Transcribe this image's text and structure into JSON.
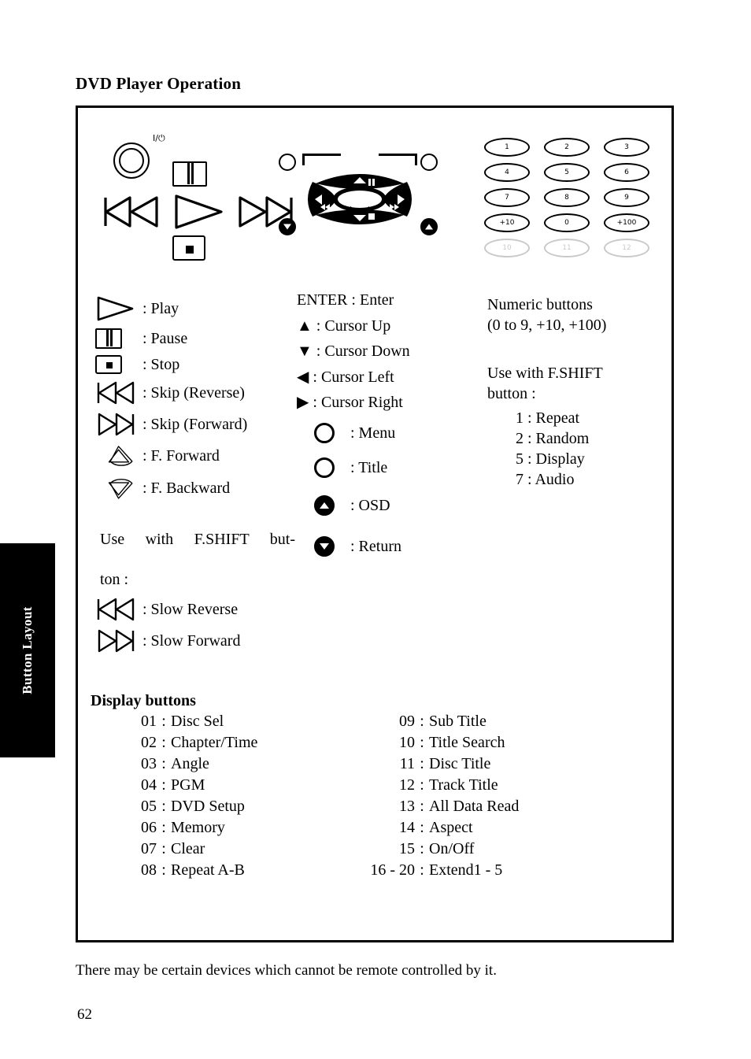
{
  "page": {
    "title": "DVD Player Operation",
    "side_tab_label": "Button Layout",
    "footer_note": "There may be certain devices which cannot be remote controlled by it.",
    "page_number": "62"
  },
  "diagram": {
    "power_label": "I/⏻",
    "power_icon": "power-button-icon",
    "pause_icon": "pause-button-icon",
    "play_icon": "play-button-icon",
    "stop_icon": "stop-button-icon",
    "skip_reverse_icon": "skip-reverse-button-icon",
    "skip_forward_icon": "skip-forward-button-icon",
    "cursor_pad": {
      "up_secondary": "/▐▌",
      "down_secondary": "/■",
      "center": "enter-button",
      "corner_top_left": "menu-button",
      "corner_top_right": "title-button",
      "corner_bottom_left": "return-button",
      "corner_bottom_right": "osd-button"
    },
    "keypad": {
      "rows": [
        [
          "1",
          "2",
          "3"
        ],
        [
          "4",
          "5",
          "6"
        ],
        [
          "7",
          "8",
          "9"
        ],
        [
          "+10",
          "0",
          "+100"
        ]
      ],
      "ghost_row": [
        "10",
        "11",
        "12"
      ]
    }
  },
  "legend_left": {
    "items": [
      {
        "icon": "play-icon",
        "label": ": Play"
      },
      {
        "icon": "pause-icon",
        "label": ": Pause"
      },
      {
        "icon": "stop-icon",
        "label": ": Stop"
      },
      {
        "icon": "skip-reverse-icon",
        "label": ": Skip (Reverse)"
      },
      {
        "icon": "skip-forward-icon",
        "label": ": Skip (Forward)"
      },
      {
        "icon": "fast-forward-icon",
        "label": ": F. Forward"
      },
      {
        "icon": "fast-backward-icon",
        "label": ": F. Backward"
      }
    ],
    "fshift_note": "Use with F.SHIFT but-",
    "fshift_note_cont": "ton :",
    "fshift_items": [
      {
        "icon": "slow-reverse-icon",
        "label": ": Slow Reverse"
      },
      {
        "icon": "slow-forward-icon",
        "label": ": Slow Forward"
      }
    ]
  },
  "legend_mid": {
    "items": [
      "ENTER : Enter",
      "▲ : Cursor Up",
      "▼ : Cursor Down",
      "◀ : Cursor Left",
      "▶ : Cursor Right"
    ],
    "circle_items": [
      {
        "icon": "menu-circle-icon",
        "label": ":  Menu"
      },
      {
        "icon": "title-circle-icon",
        "label": ":  Title"
      },
      {
        "icon": "osd-circle-icon",
        "label": ":   OSD"
      },
      {
        "icon": "return-circle-icon",
        "label": ":   Return"
      }
    ]
  },
  "legend_right": {
    "heading_line1": "Numeric buttons",
    "heading_line2": "(0 to 9, +10, +100)",
    "fshift_line1": "Use with F.SHIFT",
    "fshift_line2": "button :",
    "fshift_items": [
      "1 : Repeat",
      "2 : Random",
      "5 : Display",
      "7 : Audio"
    ]
  },
  "display_buttons": {
    "title": "Display buttons",
    "left": [
      {
        "num": "01",
        "sep": ":",
        "label": "Disc Sel"
      },
      {
        "num": "02",
        "sep": ":",
        "label": "Chapter/Time"
      },
      {
        "num": "03",
        "sep": ":",
        "label": "Angle"
      },
      {
        "num": "04",
        "sep": ":",
        "label": "PGM"
      },
      {
        "num": "05",
        "sep": ":",
        "label": "DVD Setup"
      },
      {
        "num": "06",
        "sep": ":",
        "label": "Memory"
      },
      {
        "num": "07",
        "sep": ":",
        "label": "Clear"
      },
      {
        "num": "08",
        "sep": ":",
        "label": "Repeat A-B"
      }
    ],
    "right": [
      {
        "num": "09",
        "sep": ":",
        "label": "Sub Title"
      },
      {
        "num": "10",
        "sep": ":",
        "label": "Title Search"
      },
      {
        "num": "11",
        "sep": ":",
        "label": "Disc Title"
      },
      {
        "num": "12",
        "sep": ":",
        "label": "Track Title"
      },
      {
        "num": "13",
        "sep": ":",
        "label": "All Data Read"
      },
      {
        "num": "14",
        "sep": ":",
        "label": "Aspect"
      },
      {
        "num": "15",
        "sep": ":",
        "label": "On/Off"
      },
      {
        "num": "16 - 20",
        "sep": ":",
        "label": "Extend1 - 5"
      }
    ]
  }
}
